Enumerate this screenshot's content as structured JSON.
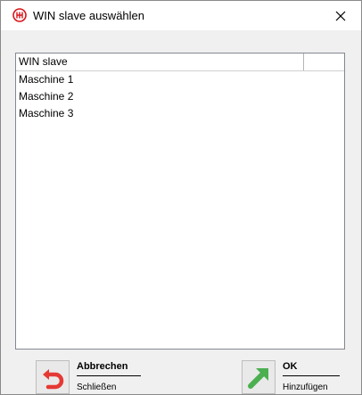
{
  "window": {
    "title": "WIN slave auswählen",
    "app_icon": "logo-icon",
    "close_icon": "close-icon"
  },
  "list": {
    "columns": [
      "WIN slave",
      ""
    ],
    "rows": [
      "Maschine 1",
      "Maschine 2",
      "Maschine 3"
    ]
  },
  "buttons": {
    "cancel": {
      "label": "Abbrechen",
      "sublabel": "Schließen",
      "icon": "undo-arrow-icon"
    },
    "ok": {
      "label": "OK",
      "sublabel": "Hinzufügen",
      "icon": "diagonal-arrow-icon"
    }
  },
  "colors": {
    "accent_red": "#d7141a",
    "ok_green": "#4caf50"
  }
}
